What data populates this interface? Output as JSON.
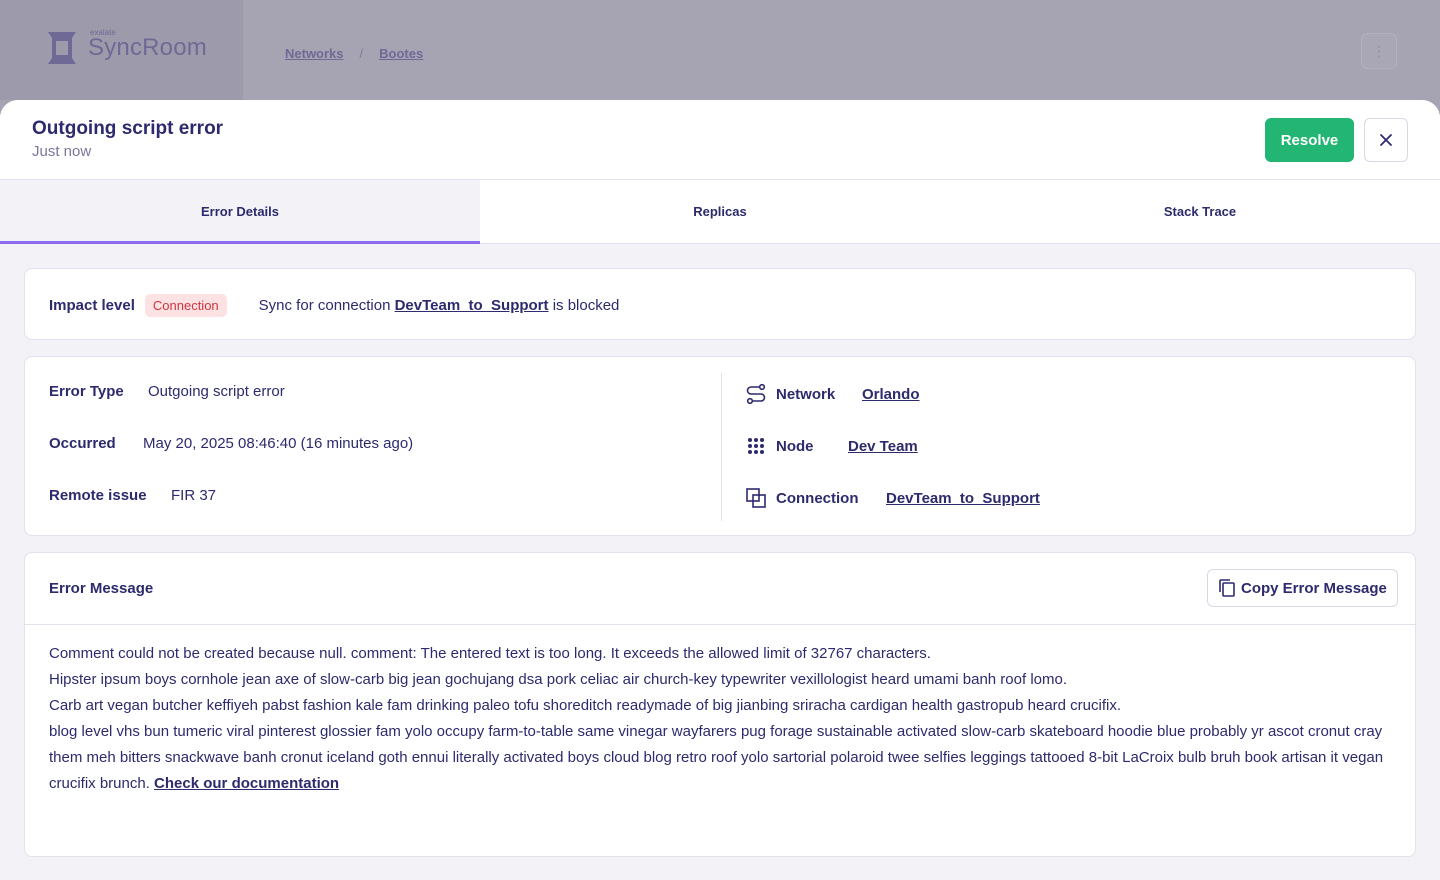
{
  "background": {
    "brand_small": "exalate",
    "brand_name": "SyncRoom",
    "breadcrumbs": [
      "Networks",
      "Bootes"
    ],
    "kebab_icon": "more-vertical-icon"
  },
  "header": {
    "title": "Outgoing script error",
    "subtitle": "Just now",
    "resolve_label": "Resolve",
    "close_icon": "close-icon"
  },
  "tabs": [
    {
      "label": "Error Details",
      "active": true
    },
    {
      "label": "Replicas",
      "active": false
    },
    {
      "label": "Stack Trace",
      "active": false
    }
  ],
  "impact": {
    "label": "Impact level",
    "badge": "Connection",
    "text_prefix": "Sync for connection",
    "link": "DevTeam_to_Support",
    "text_suffix": "is blocked"
  },
  "details": {
    "left": [
      {
        "label": "Error Type",
        "value": "Outgoing script error"
      },
      {
        "label": "Occurred",
        "value": "May 20, 2025 08:46:40 (16 minutes ago)"
      },
      {
        "label": "Remote issue",
        "value": "FIR 37"
      }
    ],
    "right": [
      {
        "icon": "network-icon",
        "label": "Network",
        "value": "Orlando"
      },
      {
        "icon": "node-grid-icon",
        "label": "Node",
        "value": "Dev Team"
      },
      {
        "icon": "connection-icon",
        "label": "Connection",
        "value": "DevTeam_to_Support"
      }
    ]
  },
  "error_message": {
    "title": "Error Message",
    "copy_label": "Copy Error Message",
    "copy_icon": "copy-icon",
    "lines": [
      "Comment could not be created because null. comment: The entered text is too long. It exceeds the allowed limit of 32767 characters.",
      "Hipster ipsum boys cornhole jean axe of slow-carb big jean gochujang dsa pork celiac air church-key typewriter vexillologist heard umami banh roof lomo.",
      "Carb art vegan butcher keffiyeh pabst fashion kale fam drinking paleo tofu shoreditch readymade of big jianbing sriracha cardigan health gastropub heard crucifix.",
      "blog level vhs bun tumeric viral pinterest glossier fam yolo occupy farm-to-table same vinegar wayfarers pug forage sustainable activated slow-carb skateboard hoodie blue probably yr ascot cronut cray them meh bitters snackwave banh cronut iceland goth ennui literally activated boys cloud blog retro roof yolo sartorial polaroid twee selfies leggings tattooed 8-bit LaCroix bulb bruh book artisan it vegan crucifix brunch."
    ],
    "doc_link": "Check our documentation"
  },
  "colors": {
    "primary_text": "#2d2a6e",
    "accent": "#8b6cf0",
    "success": "#22b573",
    "danger_bg": "#fde2e4",
    "danger_text": "#d1343f"
  }
}
